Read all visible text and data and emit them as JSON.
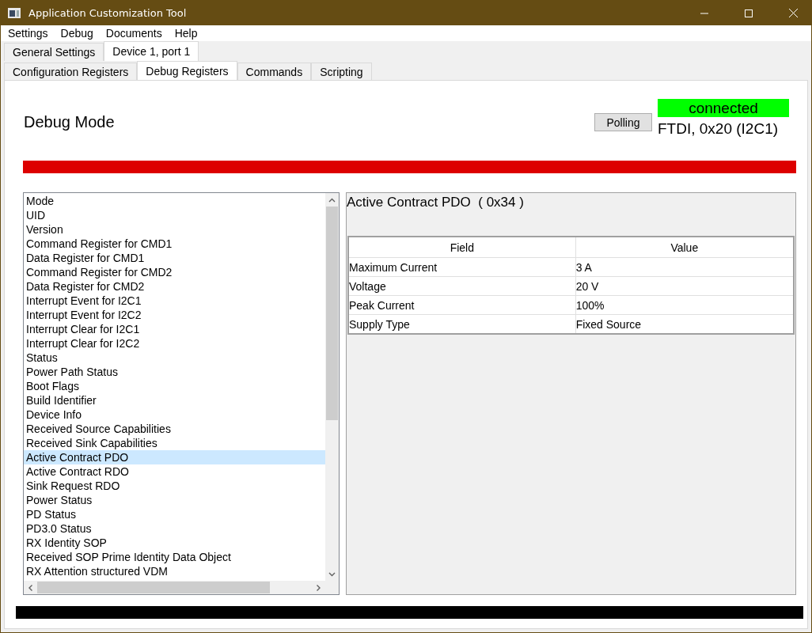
{
  "window": {
    "title": "Application Customization Tool"
  },
  "menu": [
    "Settings",
    "Debug",
    "Documents",
    "Help"
  ],
  "outer_tabs": [
    {
      "label": "General Settings",
      "selected": false
    },
    {
      "label": "Device 1, port 1",
      "selected": true
    }
  ],
  "inner_tabs": [
    {
      "label": "Configuration Registers",
      "selected": false
    },
    {
      "label": "Debug Registers",
      "selected": true
    },
    {
      "label": "Commands",
      "selected": false
    },
    {
      "label": "Scripting",
      "selected": false
    }
  ],
  "header": {
    "title": "Debug Mode",
    "polling_button": "Polling",
    "status": "connected",
    "connection": "FTDI, 0x20 (I2C1)"
  },
  "registers": [
    {
      "label": "Mode",
      "selected": false
    },
    {
      "label": "UID",
      "selected": false
    },
    {
      "label": "Version",
      "selected": false
    },
    {
      "label": "Command Register for CMD1",
      "selected": false
    },
    {
      "label": "Data Register for CMD1",
      "selected": false
    },
    {
      "label": "Command Register for CMD2",
      "selected": false
    },
    {
      "label": "Data Register for CMD2",
      "selected": false
    },
    {
      "label": "Interrupt Event for I2C1",
      "selected": false
    },
    {
      "label": "Interrupt Event for I2C2",
      "selected": false
    },
    {
      "label": "Interrupt Clear for I2C1",
      "selected": false
    },
    {
      "label": "Interrupt Clear for I2C2",
      "selected": false
    },
    {
      "label": "Status",
      "selected": false
    },
    {
      "label": "Power Path Status",
      "selected": false
    },
    {
      "label": "Boot Flags",
      "selected": false
    },
    {
      "label": "Build Identifier",
      "selected": false
    },
    {
      "label": "Device Info",
      "selected": false
    },
    {
      "label": "Received Source Capabilities",
      "selected": false
    },
    {
      "label": "Received Sink Capabilities",
      "selected": false
    },
    {
      "label": "Active Contract PDO",
      "selected": true
    },
    {
      "label": "Active Contract RDO",
      "selected": false
    },
    {
      "label": "Sink Request RDO",
      "selected": false
    },
    {
      "label": "Power Status",
      "selected": false
    },
    {
      "label": "PD Status",
      "selected": false
    },
    {
      "label": "PD3.0 Status",
      "selected": false
    },
    {
      "label": "RX Identity SOP",
      "selected": false
    },
    {
      "label": "Received SOP Prime Identity Data Object",
      "selected": false
    },
    {
      "label": "RX Attention structured VDM",
      "selected": false
    }
  ],
  "detail": {
    "title": "Active Contract PDO  ( 0x34 )",
    "columns": [
      "Field",
      "Value"
    ],
    "rows": [
      [
        "Maximum Current",
        "3 A"
      ],
      [
        "Voltage",
        "20 V"
      ],
      [
        "Peak Current",
        "100%"
      ],
      [
        "Supply Type",
        "Fixed Source"
      ]
    ]
  }
}
